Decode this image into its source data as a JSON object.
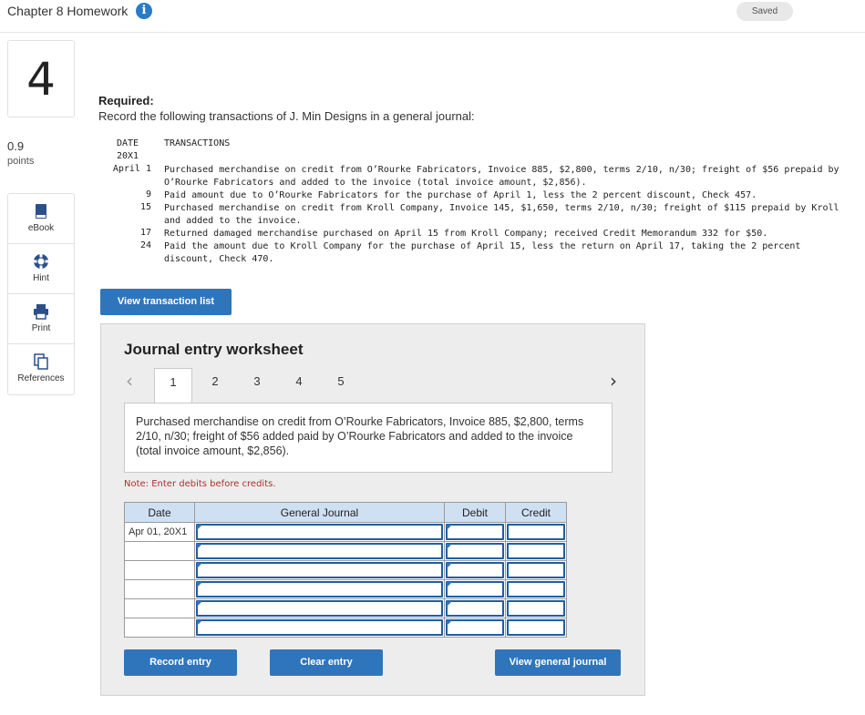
{
  "header": {
    "title": "Chapter 8 Homework",
    "saved": "Saved"
  },
  "question": {
    "number": "4",
    "score": "0.9",
    "score_label": "points"
  },
  "tools": [
    {
      "label": "eBook",
      "icon": "book-icon"
    },
    {
      "label": "Hint",
      "icon": "lifebuoy-icon"
    },
    {
      "label": "Print",
      "icon": "printer-icon"
    },
    {
      "label": "References",
      "icon": "documents-icon"
    }
  ],
  "instructions": {
    "required_label": "Required:",
    "text": "Record the following transactions of J. Min Designs in a general journal:"
  },
  "transactions": {
    "date_header": "DATE",
    "year": "20X1",
    "desc_header": "TRANSACTIONS",
    "rows": [
      {
        "date": "April 1",
        "text": "Purchased merchandise on credit from O’Rourke Fabricators, Invoice 885, $2,800, terms 2/10, n/30; freight of $56 prepaid by O’Rourke Fabricators and added to the invoice (total invoice amount, $2,856)."
      },
      {
        "date": "9",
        "text": "Paid amount due to O’Rourke Fabricators for the purchase of April 1, less the 2 percent discount, Check 457."
      },
      {
        "date": "15",
        "text": "Purchased merchandise on credit from Kroll Company, Invoice 145, $1,650, terms 2/10, n/30; freight of $115 prepaid by Kroll and added to the invoice."
      },
      {
        "date": "17",
        "text": "Returned damaged merchandise purchased on April 15 from Kroll Company; received Credit Memorandum 332 for $50."
      },
      {
        "date": "24",
        "text": "Paid the amount due to Kroll Company for the purchase of April 15, less the return on April 17, taking the 2 percent discount, Check 470."
      }
    ]
  },
  "buttons": {
    "view_transaction_list": "View transaction list",
    "record_entry": "Record entry",
    "clear_entry": "Clear entry",
    "view_general_journal": "View general journal"
  },
  "worksheet": {
    "title": "Journal entry worksheet",
    "tabs": [
      "1",
      "2",
      "3",
      "4",
      "5"
    ],
    "active_tab": "1",
    "prev_icon": "‹",
    "next_icon": "›",
    "description": "Purchased merchandise on credit from O’Rourke Fabricators, Invoice 885, $2,800, terms 2/10, n/30; freight of $56 added paid by O’Rourke Fabricators and added to the invoice (total invoice amount, $2,856).",
    "note": "Note: Enter debits before credits.",
    "table": {
      "headers": [
        "Date",
        "General Journal",
        "Debit",
        "Credit"
      ],
      "first_date": "Apr 01, 20X1",
      "rows": [
        {
          "date": "Apr 01, 20X1",
          "account": "",
          "debit": "",
          "credit": ""
        },
        {
          "date": "",
          "account": "",
          "debit": "",
          "credit": ""
        },
        {
          "date": "",
          "account": "",
          "debit": "",
          "credit": ""
        },
        {
          "date": "",
          "account": "",
          "debit": "",
          "credit": ""
        },
        {
          "date": "",
          "account": "",
          "debit": "",
          "credit": ""
        },
        {
          "date": "",
          "account": "",
          "debit": "",
          "credit": ""
        }
      ]
    }
  },
  "colors": {
    "accent": "#2f75bb",
    "table_header": "#cfe0f3",
    "note": "#b03030"
  }
}
